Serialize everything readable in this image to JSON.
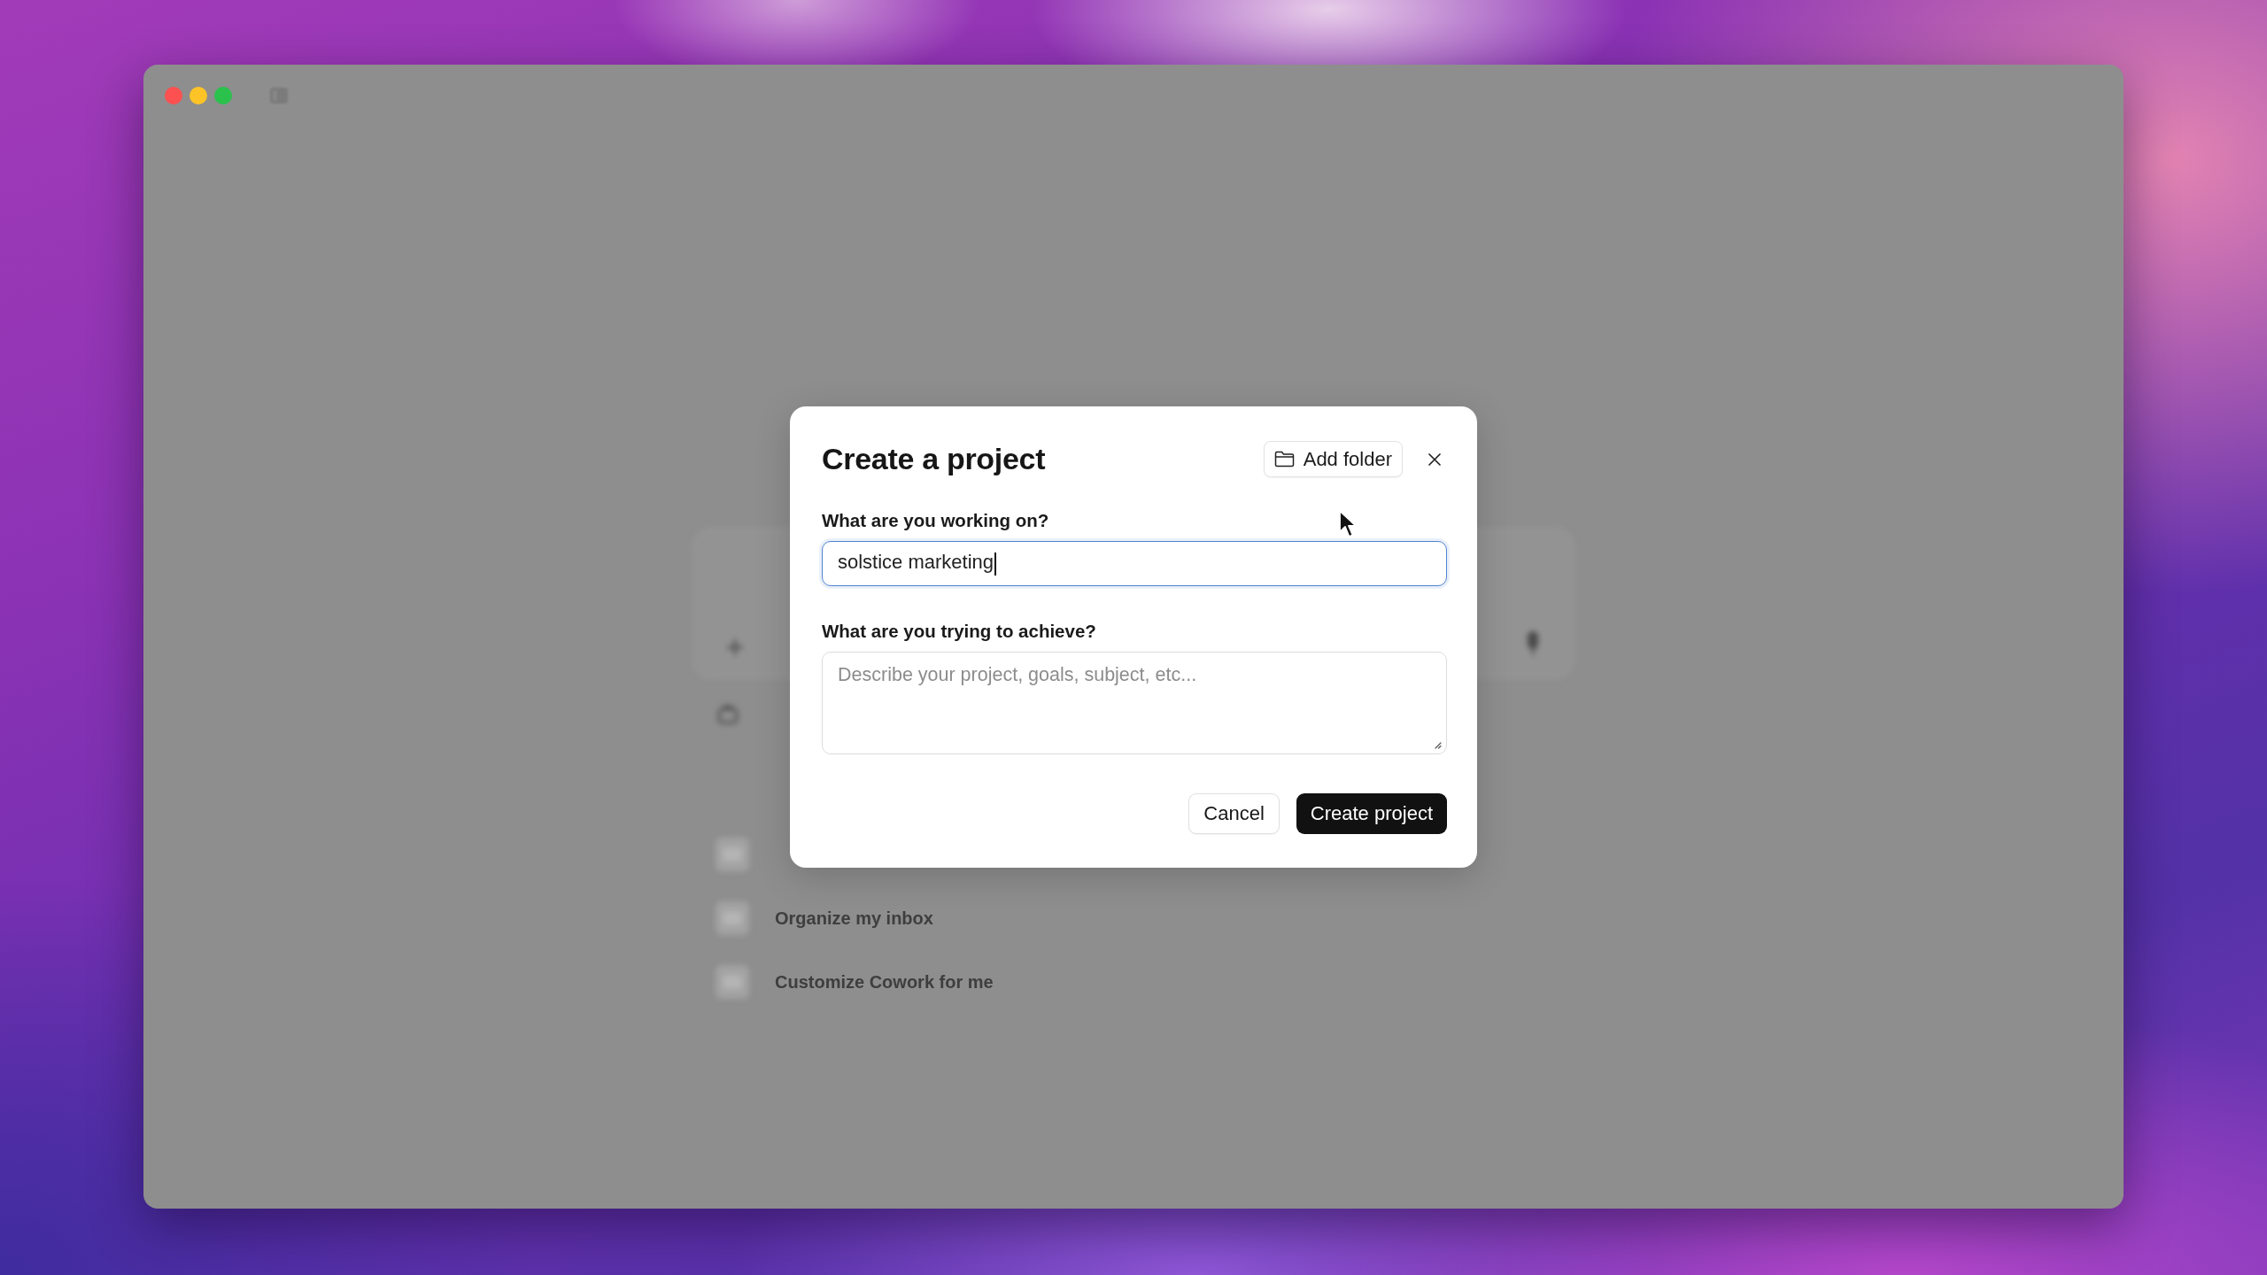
{
  "window": {
    "controls": [
      {
        "color": "#fd5050"
      },
      {
        "color": "#fec427"
      },
      {
        "color": "#2ac14d"
      }
    ]
  },
  "background": {
    "ideas": [
      {
        "label": "Organize my inbox"
      },
      {
        "label": "Customize Cowork for me"
      }
    ]
  },
  "dialog": {
    "title": "Create a project",
    "add_folder_button": "Add folder",
    "fields": [
      {
        "kind": "input",
        "label": "What are you working on?",
        "value": "solstice marketing",
        "focused": true
      },
      {
        "kind": "textarea",
        "label": "What are you trying to achieve?",
        "placeholder": "Describe your project, goals, subject, etc...",
        "focused": false
      }
    ],
    "buttons": [
      {
        "kind": "secondary",
        "label": "Cancel"
      },
      {
        "kind": "primary",
        "label": "Create project"
      }
    ]
  }
}
